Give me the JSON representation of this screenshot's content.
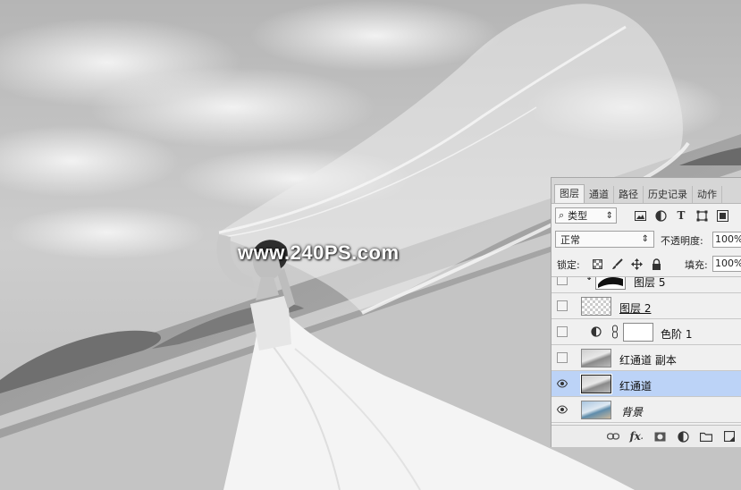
{
  "watermark": "www.240PS.com",
  "panel": {
    "tabs": [
      {
        "label": "图层",
        "active": true
      },
      {
        "label": "通道",
        "active": false
      },
      {
        "label": "路径",
        "active": false
      },
      {
        "label": "历史记录",
        "active": false
      },
      {
        "label": "动作",
        "active": false
      }
    ],
    "filter": {
      "icon": "search-icon",
      "label": "类型",
      "arrows": "⇕"
    },
    "blend": {
      "mode": "正常",
      "arrows": "⇕",
      "opacity_label": "不透明度:",
      "opacity_value": "100%"
    },
    "lock": {
      "label": "锁定:",
      "fill_label": "填充:",
      "fill_value": "100%"
    },
    "layers": [
      {
        "name": "图层 5",
        "visible": false,
        "thumb": "mask-photo",
        "selected": false
      },
      {
        "name": "图层 2",
        "visible": false,
        "thumb": "transparent",
        "selected": false
      },
      {
        "name": "色阶 1",
        "visible": false,
        "thumb": "adjustment-levels",
        "selected": false
      },
      {
        "name": "红通道 副本",
        "visible": false,
        "thumb": "gray-photo",
        "selected": false
      },
      {
        "name": "红通道",
        "visible": true,
        "thumb": "gray-photo",
        "selected": true
      },
      {
        "name": "背景",
        "visible": true,
        "thumb": "color-photo",
        "selected": false
      }
    ],
    "bottom_icons": [
      "link-icon",
      "fx-icon",
      "add-mask-icon",
      "adjustment-icon",
      "folder-icon",
      "new-layer-icon"
    ],
    "colors": {
      "selected_row": "#bcd3f7",
      "panel_bg": "#f0f0f0",
      "tabbar_bg": "#d6d6d6"
    }
  }
}
